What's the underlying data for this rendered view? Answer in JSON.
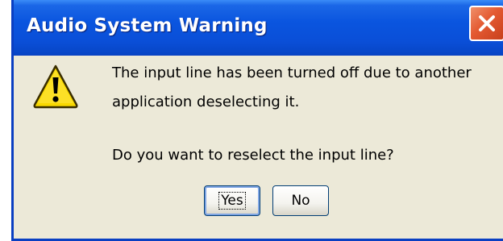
{
  "dialog": {
    "title": "Audio System Warning",
    "icon": "warning-icon",
    "message_line_1": "The input line has been turned off due to another",
    "message_line_2": "application deselecting it.",
    "question": "Do you want to reselect the input line?",
    "buttons": {
      "yes_label": "Yes",
      "no_label": "No"
    },
    "default_button": "Yes"
  },
  "colors": {
    "titlebar": "#0a55df",
    "dialog_background": "#ece9d8",
    "close_button": "#e45a32",
    "warning_yellow": "#f8d800"
  }
}
